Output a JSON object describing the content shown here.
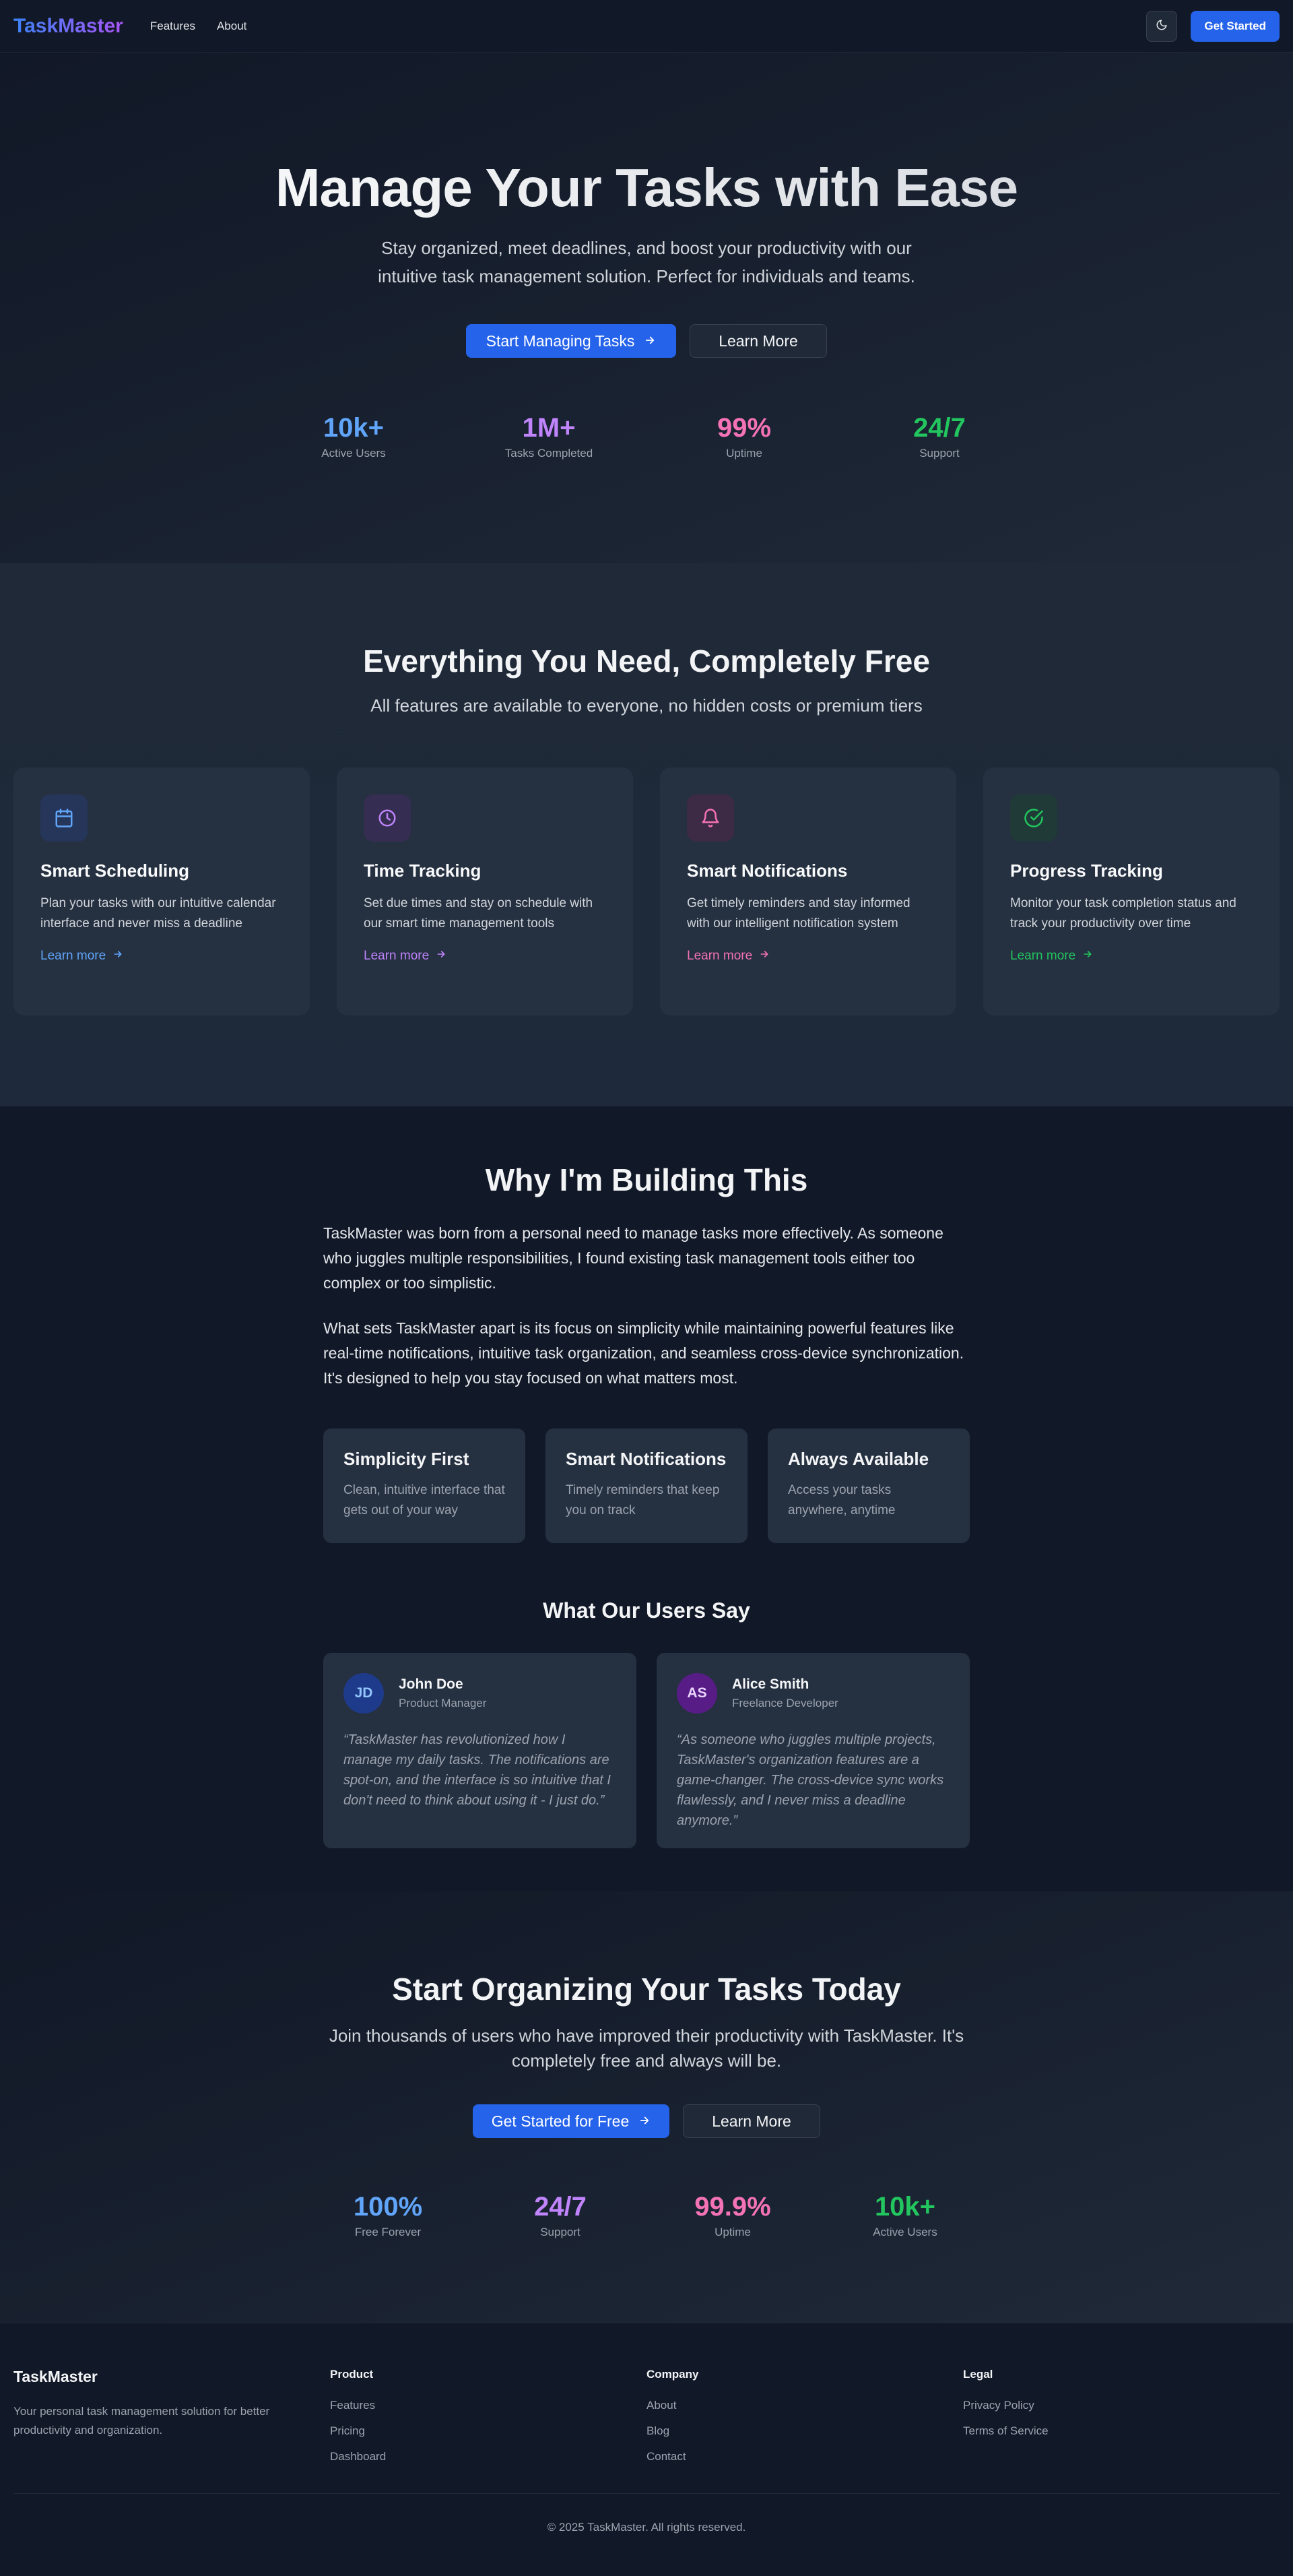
{
  "nav": {
    "brand": "TaskMaster",
    "links": [
      "Features",
      "About"
    ],
    "cta": "Get Started",
    "theme_icon": "moon-icon"
  },
  "hero": {
    "title": "Manage Your Tasks with Ease",
    "subtitle": "Stay organized, meet deadlines, and boost your productivity with our intuitive task management solution. Perfect for individuals and teams.",
    "primary_cta": "Start Managing Tasks",
    "secondary_cta": "Learn More",
    "stats": [
      {
        "value": "10k+",
        "label": "Active Users",
        "color": "#60a5fa"
      },
      {
        "value": "1M+",
        "label": "Tasks Completed",
        "color": "#c084fc"
      },
      {
        "value": "99%",
        "label": "Uptime",
        "color": "#f472b6"
      },
      {
        "value": "24/7",
        "label": "Support",
        "color": "#22c55e"
      }
    ]
  },
  "features": {
    "title": "Everything You Need, Completely Free",
    "subtitle": "All features are available to everyone, no hidden costs or premium tiers",
    "cards": [
      {
        "title": "Smart Scheduling",
        "text": "Plan your tasks with our intuitive calendar interface and never miss a deadline",
        "link": "Learn more",
        "icon": "calendar-icon",
        "color": "#60a5fa",
        "bg": "#26365a"
      },
      {
        "title": "Time Tracking",
        "text": "Set due times and stay on schedule with our smart time management tools",
        "link": "Learn more",
        "icon": "clock-icon",
        "color": "#c084fc",
        "bg": "#352d52"
      },
      {
        "title": "Smart Notifications",
        "text": "Get timely reminders and stay informed with our intelligent notification system",
        "link": "Learn more",
        "icon": "bell-icon",
        "color": "#f472b6",
        "bg": "#3d2a45"
      },
      {
        "title": "Progress Tracking",
        "text": "Monitor your task completion status and track your productivity over time",
        "link": "Learn more",
        "icon": "check-circle-icon",
        "color": "#22c55e",
        "bg": "#1f3a37"
      }
    ]
  },
  "about": {
    "title": "Why I'm Building This",
    "paragraphs": [
      "TaskMaster was born from a personal need to manage tasks more effectively. As someone who juggles multiple responsibilities, I found existing task management tools either too complex or too simplistic.",
      "What sets TaskMaster apart is its focus on simplicity while maintaining powerful features like real-time notifications, intuitive task organization, and seamless cross-device synchronization. It's designed to help you stay focused on what matters most."
    ],
    "pillars": [
      {
        "title": "Simplicity First",
        "text": "Clean, intuitive interface that gets out of your way"
      },
      {
        "title": "Smart Notifications",
        "text": "Timely reminders that keep you on track"
      },
      {
        "title": "Always Available",
        "text": "Access your tasks anywhere, anytime"
      }
    ],
    "testimonials_title": "What Our Users Say",
    "testimonials": [
      {
        "initials": "JD",
        "name": "John Doe",
        "role": "Product Manager",
        "quote": "“TaskMaster has revolutionized how I manage my daily tasks. The notifications are spot-on, and the interface is so intuitive that I don't need to think about using it - I just do.”",
        "avatar_bg": "#1e3a8a",
        "avatar_fg": "#93c5fd"
      },
      {
        "initials": "AS",
        "name": "Alice Smith",
        "role": "Freelance Developer",
        "quote": "“As someone who juggles multiple projects, TaskMaster's organization features are a game-changer. The cross-device sync works flawlessly, and I never miss a deadline anymore.”",
        "avatar_bg": "#581c87",
        "avatar_fg": "#e9d5ff"
      }
    ]
  },
  "cta": {
    "title": "Start Organizing Your Tasks Today",
    "subtitle": "Join thousands of users who have improved their productivity with TaskMaster. It's completely free and always will be.",
    "primary_cta": "Get Started for Free",
    "secondary_cta": "Learn More",
    "stats": [
      {
        "value": "100%",
        "label": "Free Forever",
        "color": "#60a5fa"
      },
      {
        "value": "24/7",
        "label": "Support",
        "color": "#c084fc"
      },
      {
        "value": "99.9%",
        "label": "Uptime",
        "color": "#f472b6"
      },
      {
        "value": "10k+",
        "label": "Active Users",
        "color": "#22c55e"
      }
    ]
  },
  "footer": {
    "brand": "TaskMaster",
    "description": "Your personal task management solution for better productivity and organization.",
    "columns": [
      {
        "title": "Product",
        "links": [
          "Features",
          "Pricing",
          "Dashboard"
        ]
      },
      {
        "title": "Company",
        "links": [
          "About",
          "Blog",
          "Contact"
        ]
      },
      {
        "title": "Legal",
        "links": [
          "Privacy Policy",
          "Terms of Service"
        ]
      }
    ],
    "copyright": "© 2025 TaskMaster. All rights reserved."
  }
}
